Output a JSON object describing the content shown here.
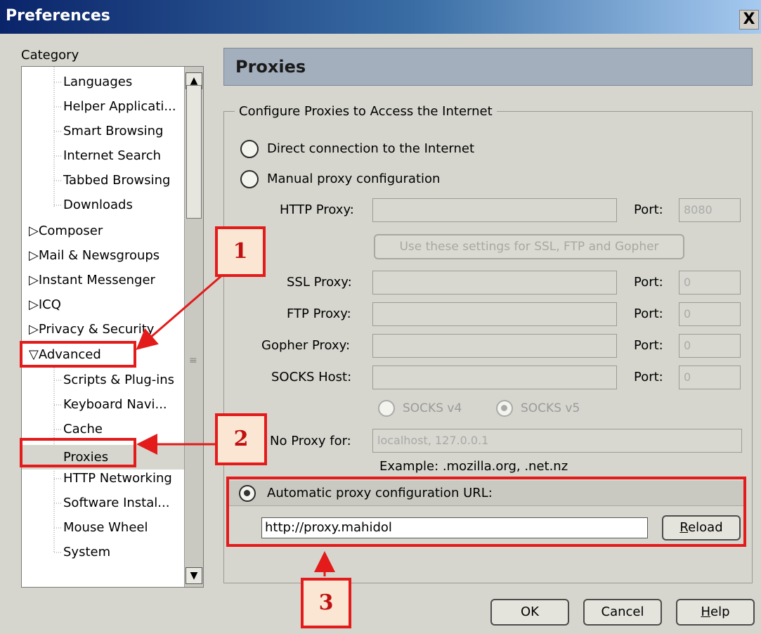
{
  "window": {
    "title": "Preferences",
    "close_glyph": "X"
  },
  "category_label": "Category",
  "tree": {
    "items": [
      {
        "label": "Languages"
      },
      {
        "label": "Helper Applicati..."
      },
      {
        "label": "Smart Browsing"
      },
      {
        "label": "Internet Search"
      },
      {
        "label": "Tabbed Browsing"
      },
      {
        "label": "Downloads"
      },
      {
        "label": "Composer",
        "expander": "▷"
      },
      {
        "label": "Mail & Newsgroups",
        "expander": "▷"
      },
      {
        "label": "Instant Messenger",
        "expander": "▷"
      },
      {
        "label": "ICQ",
        "expander": "▷"
      },
      {
        "label": "Privacy & Security",
        "expander": "▷"
      },
      {
        "label": "Advanced",
        "expander": "▽"
      },
      {
        "label": "Scripts & Plug-ins"
      },
      {
        "label": "Keyboard Navi..."
      },
      {
        "label": "Cache"
      },
      {
        "label": "Proxies",
        "selected": true
      },
      {
        "label": "HTTP Networking"
      },
      {
        "label": "Software Instal..."
      },
      {
        "label": "Mouse Wheel"
      },
      {
        "label": "System"
      }
    ]
  },
  "panel": {
    "title": "Proxies",
    "group_label": "Configure Proxies to Access the Internet",
    "direct_label": "Direct connection to the Internet",
    "manual_label": "Manual proxy configuration",
    "http_proxy_label": "HTTP Proxy:",
    "port_label": "Port:",
    "http_port_value": "8080",
    "use_same_button": "Use these settings for SSL, FTP and Gopher",
    "ssl_proxy_label": "SSL Proxy:",
    "ssl_port_value": "0",
    "ftp_proxy_label": "FTP Proxy:",
    "ftp_port_value": "0",
    "gopher_proxy_label": "Gopher Proxy:",
    "gopher_port_value": "0",
    "socks_host_label": "SOCKS Host:",
    "socks_port_value": "0",
    "socks_v4_label": "SOCKS v4",
    "socks_v5_label": "SOCKS v5",
    "no_proxy_label": "No Proxy for:",
    "no_proxy_value": "localhost, 127.0.0.1",
    "example_text": "Example: .mozilla.org, .net.nz",
    "auto_label": "Automatic proxy configuration URL:",
    "auto_url_value": "http://proxy.mahidol",
    "reload_button": "Reload",
    "selected_mode": "automatic"
  },
  "buttons": {
    "ok": "OK",
    "cancel": "Cancel",
    "help": "Help"
  },
  "annotations": {
    "step1": "1",
    "step2": "2",
    "step3": "3",
    "color": "#e31b1b"
  }
}
